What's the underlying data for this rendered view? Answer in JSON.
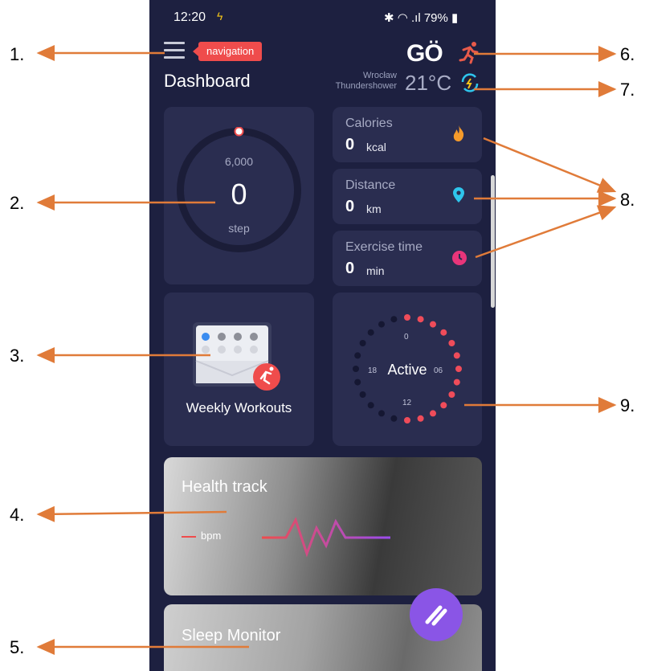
{
  "status_bar": {
    "time": "12:20",
    "battery": "79%"
  },
  "header": {
    "menu_badge": "navigation",
    "title": "Dashboard",
    "logo": "GÖ",
    "weather_city": "Wrocław",
    "weather_condition": "Thundershower",
    "temperature": "21°C"
  },
  "steps": {
    "goal": "6,000",
    "value": "0",
    "unit": "step",
    "progress": 0
  },
  "stats": [
    {
      "label": "Calories",
      "value": "0",
      "unit": "kcal",
      "icon": "flame-icon",
      "color": "#f59b2b"
    },
    {
      "label": "Distance",
      "value": "0",
      "unit": "km",
      "icon": "location-pin-icon",
      "color": "#2ec5ec"
    },
    {
      "label": "Exercise time",
      "value": "0",
      "unit": "min",
      "icon": "clock-icon",
      "color": "#e8357a"
    }
  ],
  "weekly": {
    "label": "Weekly Workouts"
  },
  "active": {
    "label": "Active",
    "dial_top": "0",
    "dial_right": "06",
    "dial_bottom": "12",
    "dial_left": "18"
  },
  "health": {
    "title": "Health track",
    "bpm_label": "bpm"
  },
  "sleep": {
    "title": "Sleep Monitor"
  },
  "callouts": [
    "1.",
    "2.",
    "3.",
    "4.",
    "5.",
    "6.",
    "7.",
    "8.",
    "9."
  ],
  "colors": {
    "background": "#1d2040",
    "card": "#2a2d50",
    "accent_red": "#ef4c4c",
    "fab": "#8a55e6",
    "arrow": "#e07b39"
  }
}
